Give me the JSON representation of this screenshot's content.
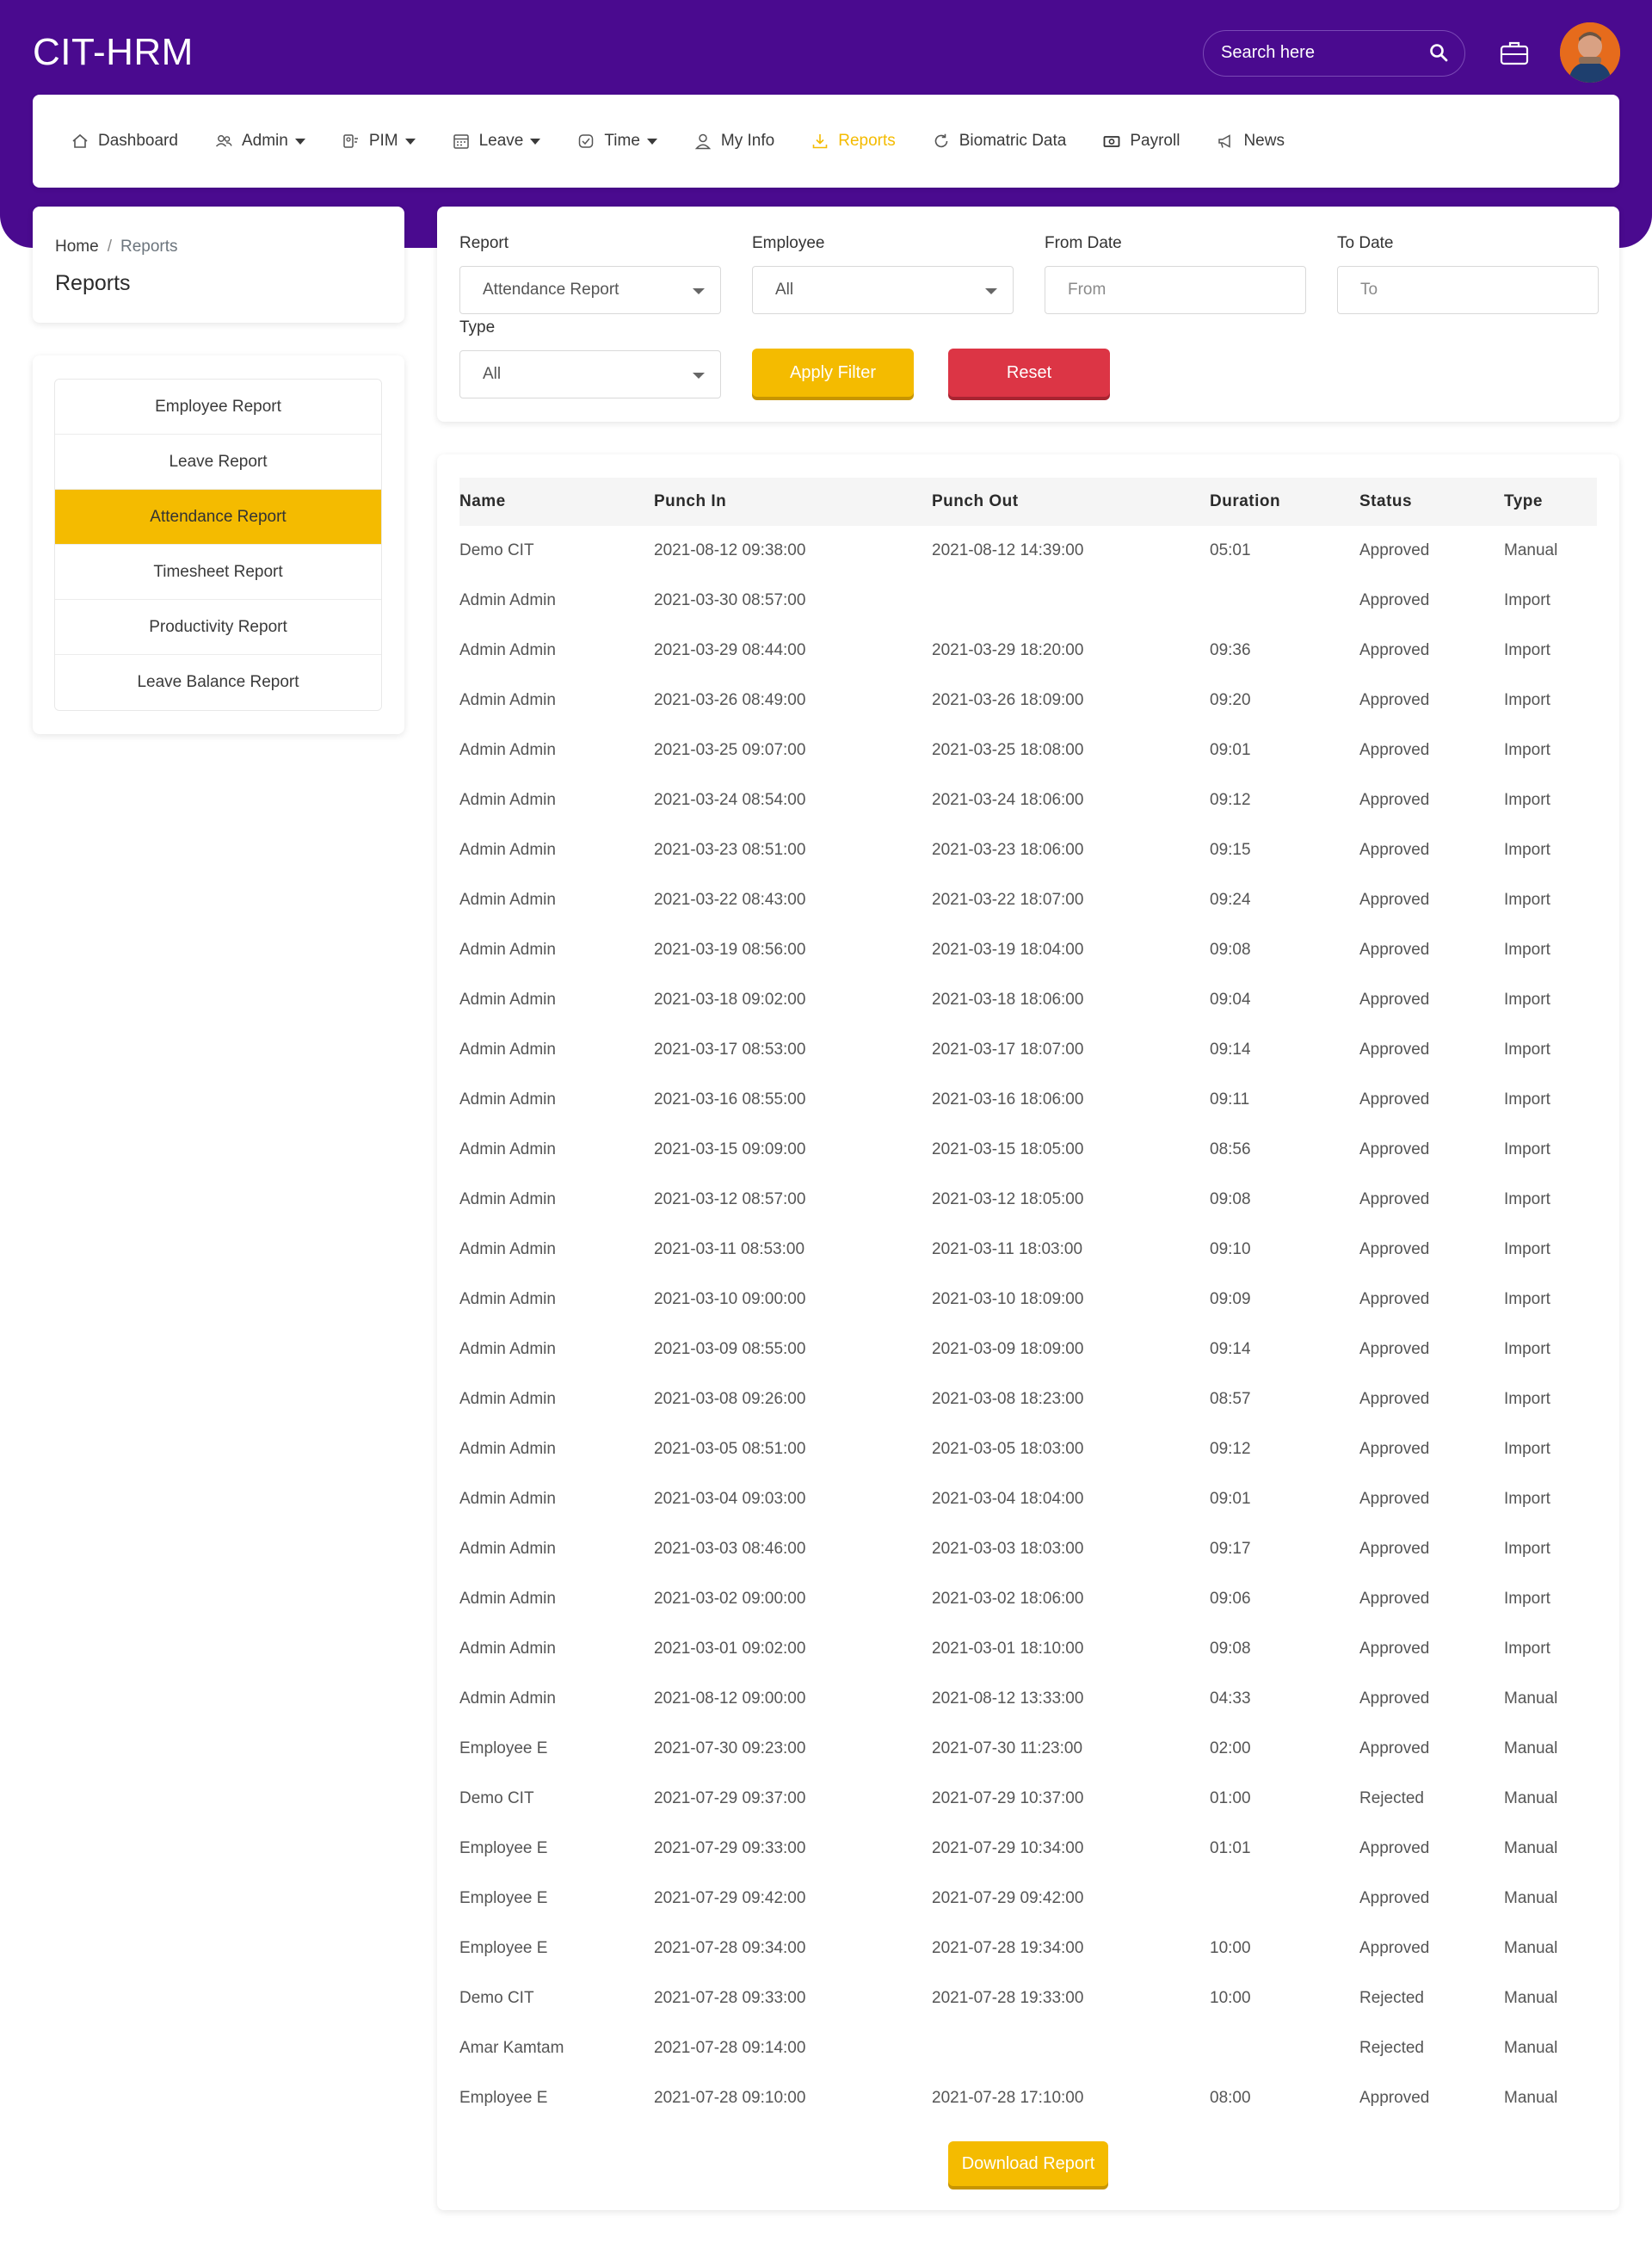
{
  "app": {
    "title": "CIT-HRM"
  },
  "search": {
    "placeholder": "Search here"
  },
  "nav": {
    "items": [
      {
        "label": "Dashboard",
        "icon": "home-icon",
        "dropdown": false,
        "active": false
      },
      {
        "label": "Admin",
        "icon": "users-icon",
        "dropdown": true,
        "active": false
      },
      {
        "label": "PIM",
        "icon": "id-card-icon",
        "dropdown": true,
        "active": false
      },
      {
        "label": "Leave",
        "icon": "calendar-icon",
        "dropdown": true,
        "active": false
      },
      {
        "label": "Time",
        "icon": "clock-icon",
        "dropdown": true,
        "active": false
      },
      {
        "label": "My Info",
        "icon": "user-icon",
        "dropdown": false,
        "active": false
      },
      {
        "label": "Reports",
        "icon": "download-icon",
        "dropdown": false,
        "active": true
      },
      {
        "label": "Biomatric Data",
        "icon": "refresh-icon",
        "dropdown": false,
        "active": false
      },
      {
        "label": "Payroll",
        "icon": "money-icon",
        "dropdown": false,
        "active": false
      },
      {
        "label": "News",
        "icon": "megaphone-icon",
        "dropdown": false,
        "active": false
      }
    ]
  },
  "breadcrumb": {
    "home": "Home",
    "separator": "/",
    "current": "Reports"
  },
  "page": {
    "title": "Reports"
  },
  "report_menu": {
    "items": [
      {
        "label": "Employee Report",
        "active": false
      },
      {
        "label": "Leave Report",
        "active": false
      },
      {
        "label": "Attendance Report",
        "active": true
      },
      {
        "label": "Timesheet Report",
        "active": false
      },
      {
        "label": "Productivity Report",
        "active": false
      },
      {
        "label": "Leave Balance Report",
        "active": false
      }
    ]
  },
  "filters": {
    "report_label": "Report",
    "report_value": "Attendance Report",
    "employee_label": "Employee",
    "employee_value": "All",
    "from_label": "From Date",
    "from_placeholder": "From",
    "to_label": "To Date",
    "to_placeholder": "To",
    "type_label": "Type",
    "type_value": "All",
    "apply_label": "Apply Filter",
    "reset_label": "Reset"
  },
  "table": {
    "columns": [
      "Name",
      "Punch In",
      "Punch Out",
      "Duration",
      "Status",
      "Type"
    ],
    "rows": [
      [
        "Demo CIT",
        "2021-08-12 09:38:00",
        "2021-08-12 14:39:00",
        "05:01",
        "Approved",
        "Manual"
      ],
      [
        "Admin Admin",
        "2021-03-30 08:57:00",
        "",
        "",
        "Approved",
        "Import"
      ],
      [
        "Admin Admin",
        "2021-03-29 08:44:00",
        "2021-03-29 18:20:00",
        "09:36",
        "Approved",
        "Import"
      ],
      [
        "Admin Admin",
        "2021-03-26 08:49:00",
        "2021-03-26 18:09:00",
        "09:20",
        "Approved",
        "Import"
      ],
      [
        "Admin Admin",
        "2021-03-25 09:07:00",
        "2021-03-25 18:08:00",
        "09:01",
        "Approved",
        "Import"
      ],
      [
        "Admin Admin",
        "2021-03-24 08:54:00",
        "2021-03-24 18:06:00",
        "09:12",
        "Approved",
        "Import"
      ],
      [
        "Admin Admin",
        "2021-03-23 08:51:00",
        "2021-03-23 18:06:00",
        "09:15",
        "Approved",
        "Import"
      ],
      [
        "Admin Admin",
        "2021-03-22 08:43:00",
        "2021-03-22 18:07:00",
        "09:24",
        "Approved",
        "Import"
      ],
      [
        "Admin Admin",
        "2021-03-19 08:56:00",
        "2021-03-19 18:04:00",
        "09:08",
        "Approved",
        "Import"
      ],
      [
        "Admin Admin",
        "2021-03-18 09:02:00",
        "2021-03-18 18:06:00",
        "09:04",
        "Approved",
        "Import"
      ],
      [
        "Admin Admin",
        "2021-03-17 08:53:00",
        "2021-03-17 18:07:00",
        "09:14",
        "Approved",
        "Import"
      ],
      [
        "Admin Admin",
        "2021-03-16 08:55:00",
        "2021-03-16 18:06:00",
        "09:11",
        "Approved",
        "Import"
      ],
      [
        "Admin Admin",
        "2021-03-15 09:09:00",
        "2021-03-15 18:05:00",
        "08:56",
        "Approved",
        "Import"
      ],
      [
        "Admin Admin",
        "2021-03-12 08:57:00",
        "2021-03-12 18:05:00",
        "09:08",
        "Approved",
        "Import"
      ],
      [
        "Admin Admin",
        "2021-03-11 08:53:00",
        "2021-03-11 18:03:00",
        "09:10",
        "Approved",
        "Import"
      ],
      [
        "Admin Admin",
        "2021-03-10 09:00:00",
        "2021-03-10 18:09:00",
        "09:09",
        "Approved",
        "Import"
      ],
      [
        "Admin Admin",
        "2021-03-09 08:55:00",
        "2021-03-09 18:09:00",
        "09:14",
        "Approved",
        "Import"
      ],
      [
        "Admin Admin",
        "2021-03-08 09:26:00",
        "2021-03-08 18:23:00",
        "08:57",
        "Approved",
        "Import"
      ],
      [
        "Admin Admin",
        "2021-03-05 08:51:00",
        "2021-03-05 18:03:00",
        "09:12",
        "Approved",
        "Import"
      ],
      [
        "Admin Admin",
        "2021-03-04 09:03:00",
        "2021-03-04 18:04:00",
        "09:01",
        "Approved",
        "Import"
      ],
      [
        "Admin Admin",
        "2021-03-03 08:46:00",
        "2021-03-03 18:03:00",
        "09:17",
        "Approved",
        "Import"
      ],
      [
        "Admin Admin",
        "2021-03-02 09:00:00",
        "2021-03-02 18:06:00",
        "09:06",
        "Approved",
        "Import"
      ],
      [
        "Admin Admin",
        "2021-03-01 09:02:00",
        "2021-03-01 18:10:00",
        "09:08",
        "Approved",
        "Import"
      ],
      [
        "Admin Admin",
        "2021-08-12 09:00:00",
        "2021-08-12 13:33:00",
        "04:33",
        "Approved",
        "Manual"
      ],
      [
        "Employee E",
        "2021-07-30 09:23:00",
        "2021-07-30 11:23:00",
        "02:00",
        "Approved",
        "Manual"
      ],
      [
        "Demo CIT",
        "2021-07-29 09:37:00",
        "2021-07-29 10:37:00",
        "01:00",
        "Rejected",
        "Manual"
      ],
      [
        "Employee E",
        "2021-07-29 09:33:00",
        "2021-07-29 10:34:00",
        "01:01",
        "Approved",
        "Manual"
      ],
      [
        "Employee E",
        "2021-07-29 09:42:00",
        "2021-07-29 09:42:00",
        "",
        "Approved",
        "Manual"
      ],
      [
        "Employee E",
        "2021-07-28 09:34:00",
        "2021-07-28 19:34:00",
        "10:00",
        "Approved",
        "Manual"
      ],
      [
        "Demo CIT",
        "2021-07-28 09:33:00",
        "2021-07-28 19:33:00",
        "10:00",
        "Rejected",
        "Manual"
      ],
      [
        "Amar Kamtam",
        "2021-07-28 09:14:00",
        "",
        "",
        "Rejected",
        "Manual"
      ],
      [
        "Employee E",
        "2021-07-28 09:10:00",
        "2021-07-28 17:10:00",
        "08:00",
        "Approved",
        "Manual"
      ]
    ]
  },
  "download": {
    "label": "Download Report"
  },
  "colors": {
    "header_bg": "#4a0a8f",
    "accent_yellow": "#f4bb00",
    "reset_red": "#dc3545",
    "text": "#3a3a3a"
  }
}
